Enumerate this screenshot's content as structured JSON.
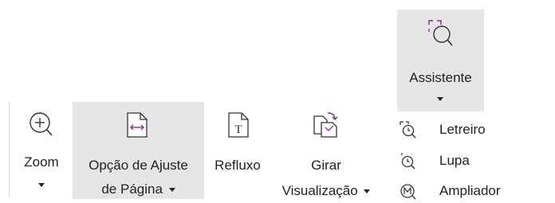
{
  "ribbon": {
    "zoom_label": "Zoom",
    "fit_option_label_line1": "Opção de Ajuste",
    "fit_option_label_line2": "de Página",
    "reflow_label": "Refluxo",
    "rotate_label_line1": "Girar",
    "rotate_label_line2": "Visualização",
    "assistant_label": "Assistente",
    "assistant_menu": [
      {
        "label": "Letreiro",
        "icon": "marquee-zoom-icon"
      },
      {
        "label": "Lupa",
        "icon": "loupe-icon"
      },
      {
        "label": "Ampliador",
        "icon": "magnifier-icon"
      }
    ],
    "accent_color": "#8b2a8f"
  }
}
